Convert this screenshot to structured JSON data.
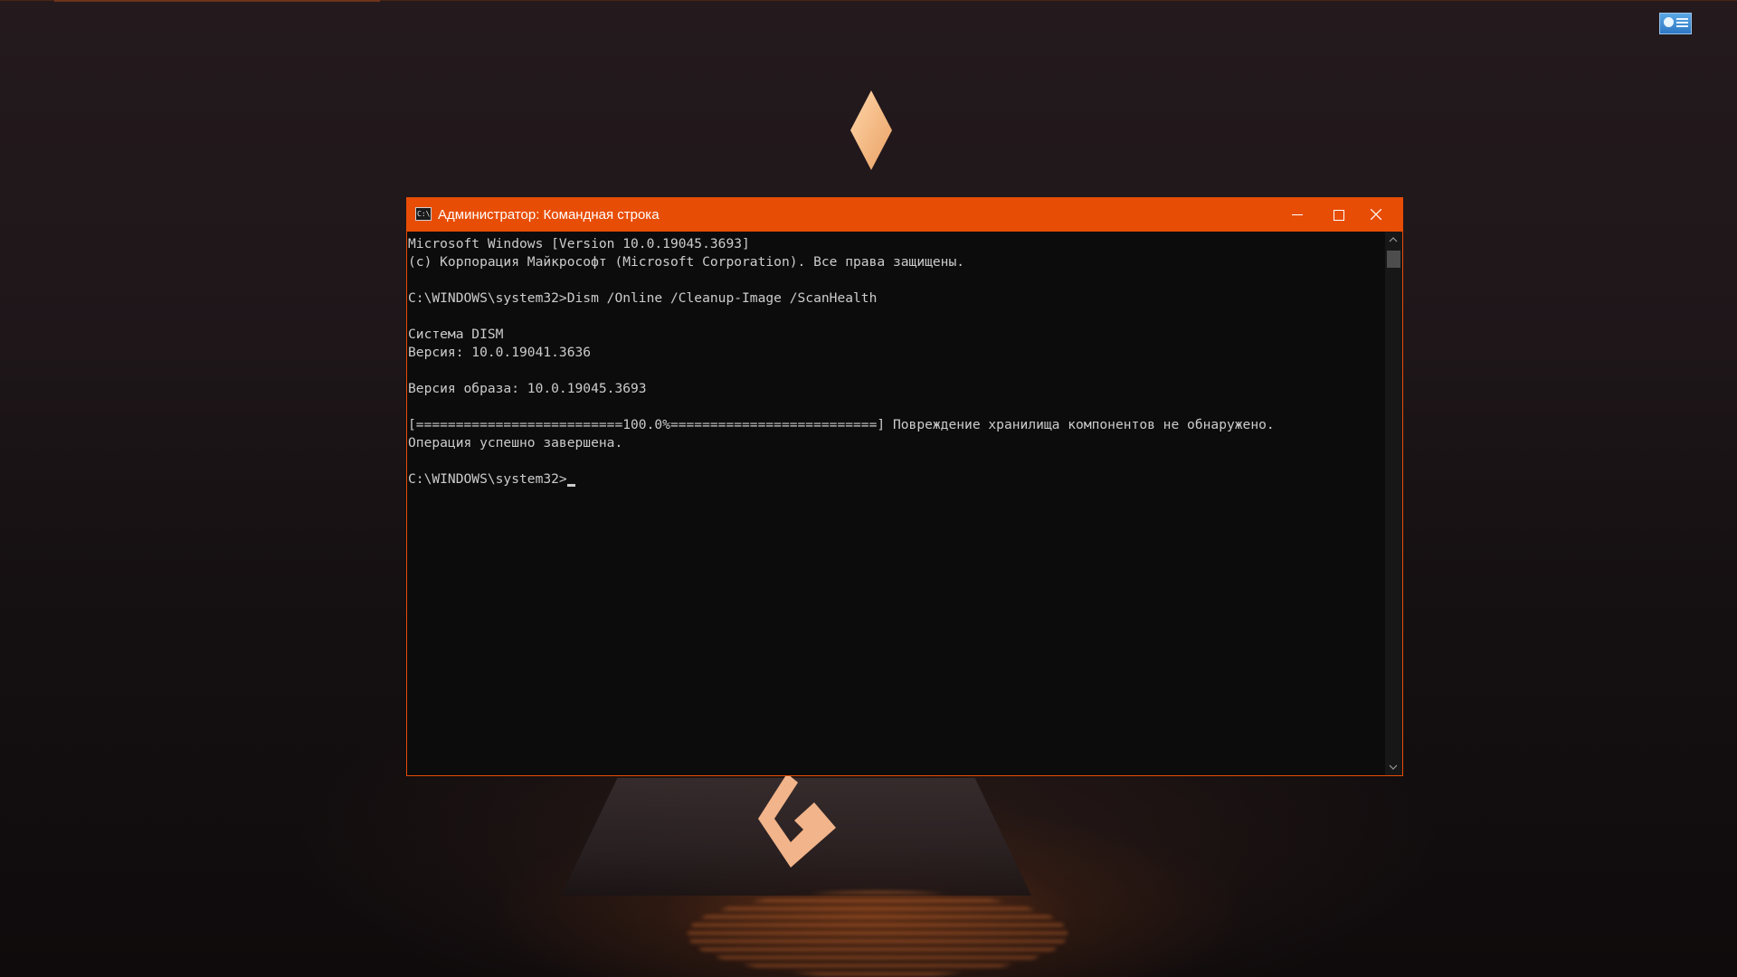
{
  "window": {
    "title": "Администратор: Командная строка",
    "icon_label": "C:\\",
    "accent_color": "#e84d06",
    "controls": {
      "minimize": "minimize-icon",
      "maximize": "maximize-icon",
      "close": "close-icon"
    }
  },
  "console": {
    "lines": [
      "Microsoft Windows [Version 10.0.19045.3693]",
      "(c) Корпорация Майкрософт (Microsoft Corporation). Все права защищены.",
      "",
      "C:\\WINDOWS\\system32>Dism /Online /Cleanup-Image /ScanHealth",
      "",
      "Система DISM",
      "Версия: 10.0.19041.3636",
      "",
      "Версия образа: 10.0.19045.3693",
      "",
      "[==========================100.0%==========================] Повреждение хранилища компонентов не обнаружено.",
      "Операция успешно завершена.",
      "",
      "C:\\WINDOWS\\system32>"
    ],
    "text_color": "#cccccc",
    "background": "#0c0c0c"
  },
  "desktop": {
    "tray_icon": "network-display-icon"
  }
}
